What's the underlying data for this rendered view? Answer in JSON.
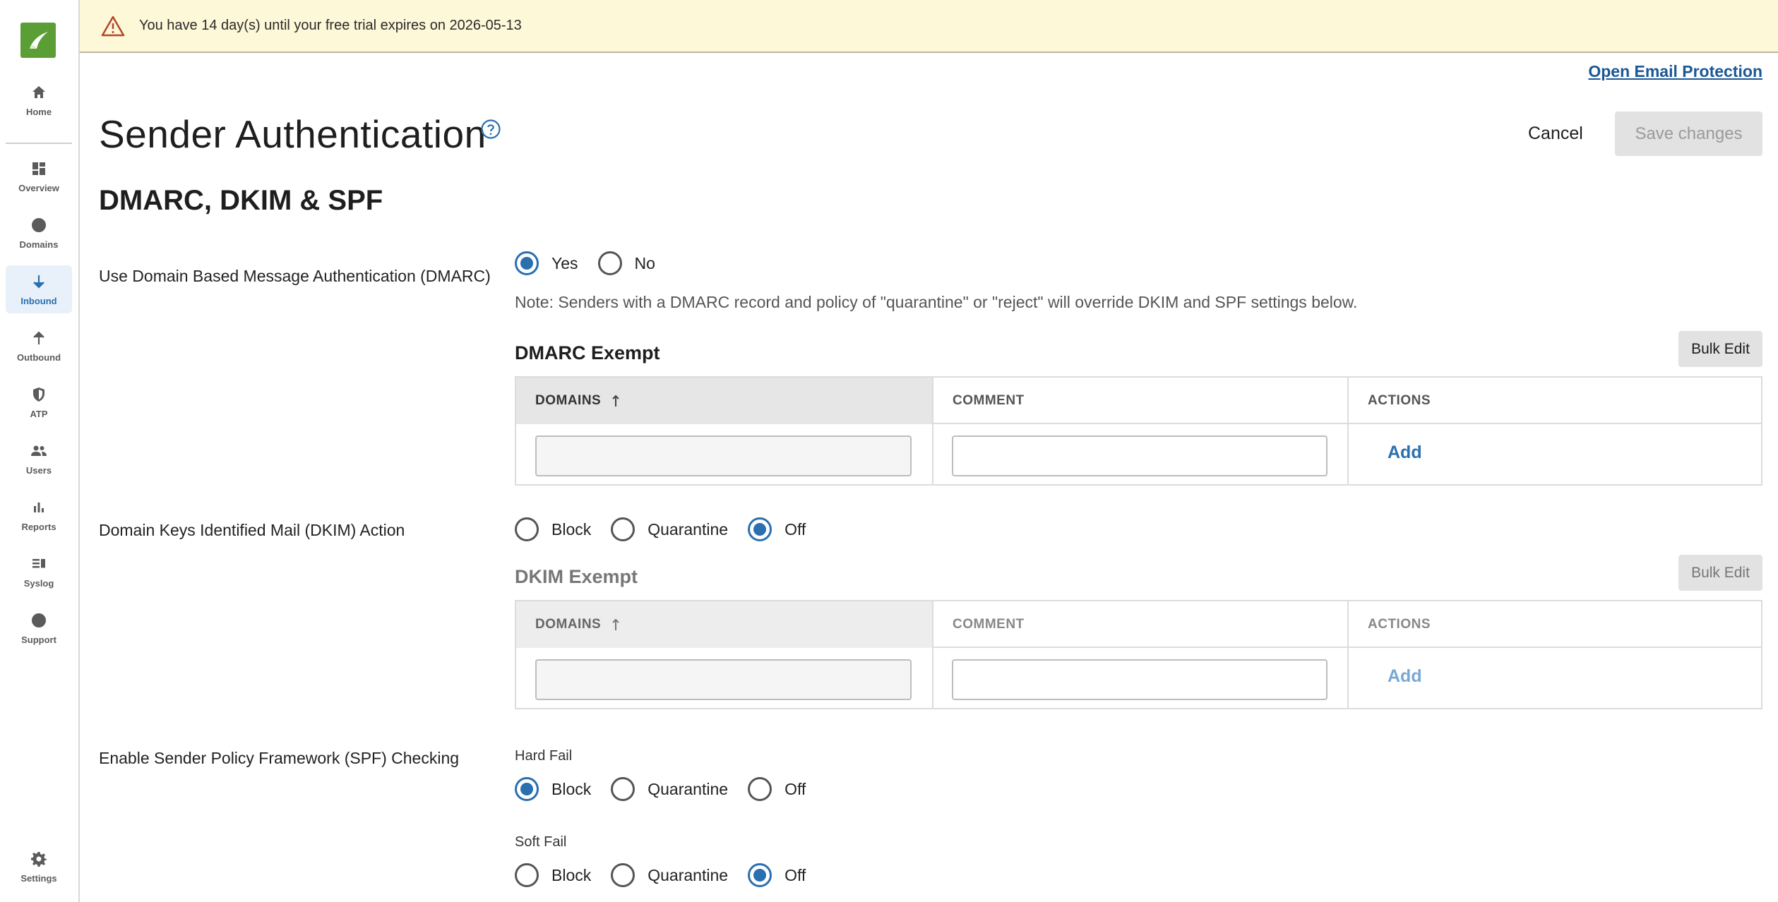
{
  "banner": {
    "text": "You have 14 day(s) until your free trial expires on 2026-05-13"
  },
  "sidebar": {
    "items": [
      {
        "label": "Home",
        "icon": "home-icon"
      },
      {
        "label": "Overview",
        "icon": "dashboard-icon"
      },
      {
        "label": "Domains",
        "icon": "globe-icon"
      },
      {
        "label": "Inbound",
        "icon": "arrow-down-icon",
        "active": true
      },
      {
        "label": "Outbound",
        "icon": "arrow-up-icon"
      },
      {
        "label": "ATP",
        "icon": "shield-icon"
      },
      {
        "label": "Users",
        "icon": "users-icon"
      },
      {
        "label": "Reports",
        "icon": "bar-chart-icon"
      },
      {
        "label": "Syslog",
        "icon": "list-icon"
      },
      {
        "label": "Support",
        "icon": "help-circle-icon"
      },
      {
        "label": "Settings",
        "icon": "gear-icon"
      }
    ]
  },
  "header": {
    "link": "Open Email Protection",
    "title": "Sender Authentication",
    "cancel": "Cancel",
    "save": "Save changes"
  },
  "section": {
    "title": "DMARC, DKIM & SPF"
  },
  "dmarc": {
    "label": "Use Domain Based Message Authentication (DMARC)",
    "options": [
      "Yes",
      "No"
    ],
    "selected": "Yes",
    "note": "Note: Senders with a DMARC record and policy of \"quarantine\" or \"reject\" will override DKIM and SPF settings below.",
    "exempt_title": "DMARC Exempt",
    "bulk_edit": "Bulk Edit",
    "columns": [
      "DOMAINS",
      "COMMENT",
      "ACTIONS"
    ],
    "add": "Add"
  },
  "dkim": {
    "label": "Domain Keys Identified Mail (DKIM) Action",
    "options": [
      "Block",
      "Quarantine",
      "Off"
    ],
    "selected": "Off",
    "exempt_title": "DKIM Exempt",
    "bulk_edit": "Bulk Edit",
    "columns": [
      "DOMAINS",
      "COMMENT",
      "ACTIONS"
    ],
    "add": "Add"
  },
  "spf": {
    "label": "Enable Sender Policy Framework (SPF) Checking",
    "hard_fail": {
      "label": "Hard Fail",
      "options": [
        "Block",
        "Quarantine",
        "Off"
      ],
      "selected": "Block"
    },
    "soft_fail": {
      "label": "Soft Fail",
      "options": [
        "Block",
        "Quarantine",
        "Off"
      ],
      "selected": "Off"
    }
  },
  "colors": {
    "accent": "#2a6fb0",
    "banner_bg": "#fdf8d8",
    "logo_green": "#5a9e35"
  }
}
